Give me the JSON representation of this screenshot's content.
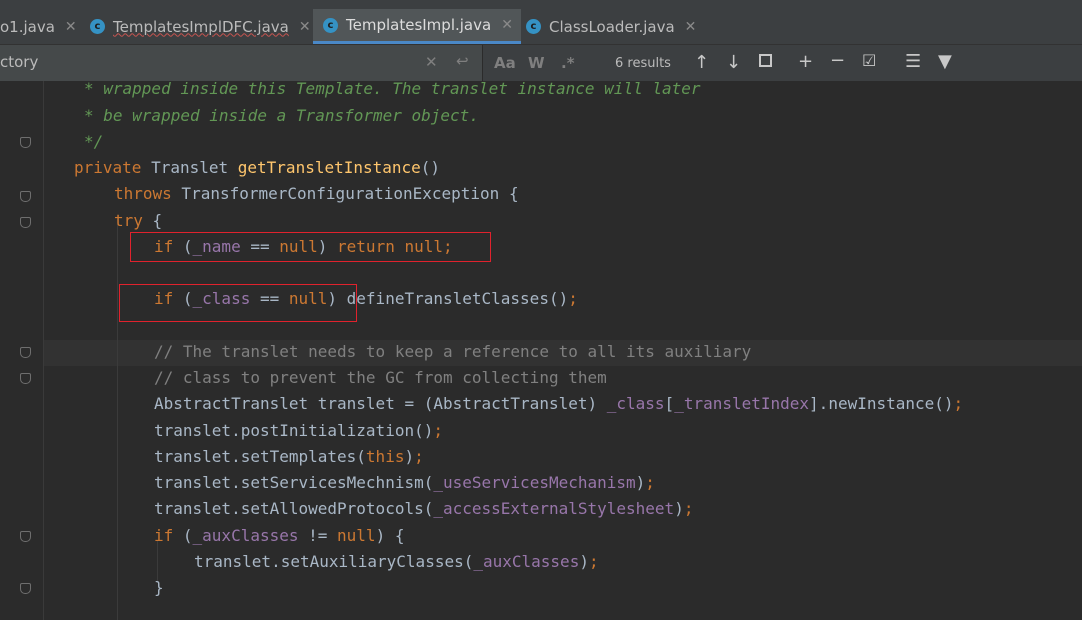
{
  "tabs": [
    {
      "label": "o1.java"
    },
    {
      "label": "TemplatesImplDFC.java"
    },
    {
      "label": "TemplatesImpl.java"
    },
    {
      "label": "ClassLoader.java"
    }
  ],
  "find": {
    "query": "ctory",
    "results": "6 results",
    "match_case": "Aa",
    "words": "W",
    "regex": ".*"
  },
  "code": {
    "l1": {
      "a": "* wrapped inside this Template. The translet instance will later"
    },
    "l2": {
      "a": "* be wrapped inside a Transformer object."
    },
    "l3": {
      "a": "*/"
    },
    "l4": {
      "a": "private",
      "b": " Translet ",
      "c": "getTransletInstance",
      "d": "()"
    },
    "l5": {
      "a": "throws",
      "b": " TransformerConfigurationException {"
    },
    "l6": {
      "a": "try",
      "b": " {"
    },
    "l7": {
      "a": "if",
      "b": " (",
      "c": "_name",
      "d": " == ",
      "e": "null",
      "f": ") ",
      "g": "return null;"
    },
    "l8": {
      "a": "if",
      "b": " (",
      "c": "_class",
      "d": " == ",
      "e": "null",
      "f": ") defineTransletClasses()",
      "g": ";"
    },
    "l9": {
      "a": "// The translet needs to keep a reference to all its auxiliary"
    },
    "l10": {
      "a": "// class to prevent the GC from collecting them"
    },
    "l11": {
      "a": "AbstractTranslet translet = (AbstractTranslet) ",
      "b": "_class",
      "c": "[",
      "d": "_transletIndex",
      "e": "].newInstance()",
      "f": ";"
    },
    "l12": {
      "a": "translet.postInitialization()",
      "b": ";"
    },
    "l13": {
      "a": "translet.setTemplates(",
      "b": "this",
      "c": ")",
      "d": ";"
    },
    "l14": {
      "a": "translet.setServicesMechnism(",
      "b": "_useServicesMechanism",
      "c": ")",
      "d": ";"
    },
    "l15": {
      "a": "translet.setAllowedProtocols(",
      "b": "_accessExternalStylesheet",
      "c": ")",
      "d": ";"
    },
    "l16": {
      "a": "if",
      "b": " (",
      "c": "_auxClasses",
      "d": " != ",
      "e": "null",
      "f": ") {"
    },
    "l17": {
      "a": "translet.setAuxiliaryClasses(",
      "b": "_auxClasses",
      "c": ")",
      "d": ";"
    },
    "l18": {
      "a": "}"
    }
  },
  "colors": {
    "keyword": "#cc7832",
    "field": "#9876aa",
    "method": "#ffc66d",
    "comment": "#808080",
    "doc_comment": "#629755",
    "highlight_box": "#e0222d"
  }
}
